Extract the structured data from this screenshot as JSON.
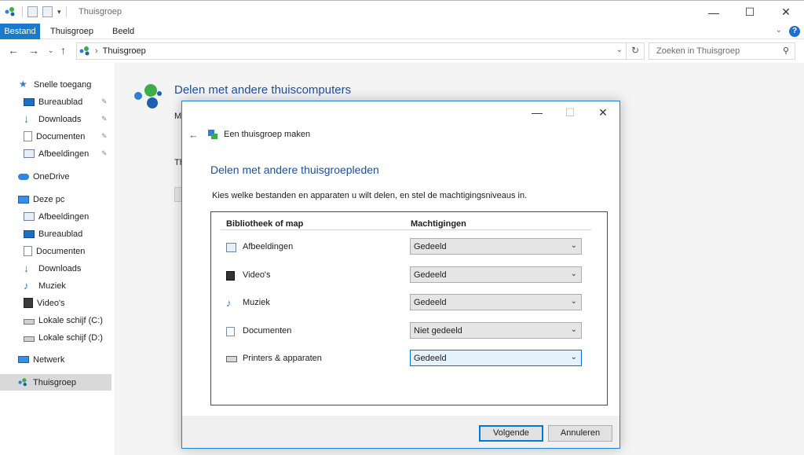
{
  "window": {
    "title": "Thuisgroep",
    "controls": {
      "minimize": "—",
      "maximize": "☐",
      "close": "✕"
    }
  },
  "ribbon": {
    "tabs": [
      "Bestand",
      "Thuisgroep",
      "Beeld"
    ],
    "help": "?"
  },
  "address": {
    "path": "Thuisgroep",
    "search_placeholder": "Zoeken in Thuisgroep"
  },
  "sidebar": {
    "quick_access": "Snelle toegang",
    "quick_items": [
      "Bureaublad",
      "Downloads",
      "Documenten",
      "Afbeeldingen"
    ],
    "onedrive": "OneDrive",
    "this_pc": "Deze pc",
    "pc_items": [
      "Afbeeldingen",
      "Bureaublad",
      "Documenten",
      "Downloads",
      "Muziek",
      "Video's",
      "Lokale schijf (C:)",
      "Lokale schijf (D:)"
    ],
    "network": "Netwerk",
    "homegroup": "Thuisgroep"
  },
  "background": {
    "heading": "Delen met andere thuiscomputers",
    "frag1": "M",
    "frag2": "Th"
  },
  "dialog": {
    "app_title": "Een thuisgroep maken",
    "heading": "Delen met andere thuisgroepleden",
    "instruction": "Kies welke bestanden en apparaten u wilt delen, en stel de machtigingsniveaus in.",
    "col_library": "Bibliotheek of map",
    "col_permissions": "Machtigingen",
    "rows": [
      {
        "label": "Afbeeldingen",
        "permission": "Gedeeld",
        "icon": "pictures-icon"
      },
      {
        "label": "Video's",
        "permission": "Gedeeld",
        "icon": "videos-icon"
      },
      {
        "label": "Muziek",
        "permission": "Gedeeld",
        "icon": "music-icon"
      },
      {
        "label": "Documenten",
        "permission": "Niet gedeeld",
        "icon": "documents-icon"
      },
      {
        "label": "Printers & apparaten",
        "permission": "Gedeeld",
        "icon": "printer-icon"
      }
    ],
    "next_button": "Volgende",
    "cancel_button": "Annuleren"
  },
  "colors": {
    "accent": "#1979ca",
    "heading_blue": "#1f4e9c",
    "dialog_border": "#1883d7"
  }
}
